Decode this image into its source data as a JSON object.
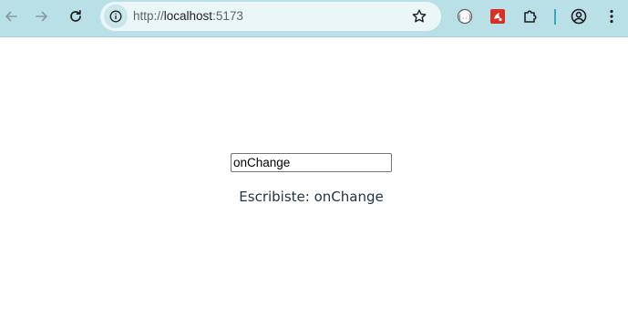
{
  "browser": {
    "url_scheme": "http://",
    "url_host": "localhost",
    "url_port": ":5173",
    "toolbar_color": "#b9e0e6",
    "icons": [
      "back-arrow-icon",
      "forward-arrow-icon",
      "reload-icon",
      "site-info-icon",
      "bookmark-star-icon",
      "extension-json-icon",
      "extension-red-icon",
      "extensions-puzzle-icon",
      "profile-avatar-icon",
      "kebab-menu-icon"
    ]
  },
  "main": {
    "input_value": "onChange",
    "echo_prefix": "Escribiste: ",
    "echo_value": "onChange",
    "text_color": "#213547"
  }
}
